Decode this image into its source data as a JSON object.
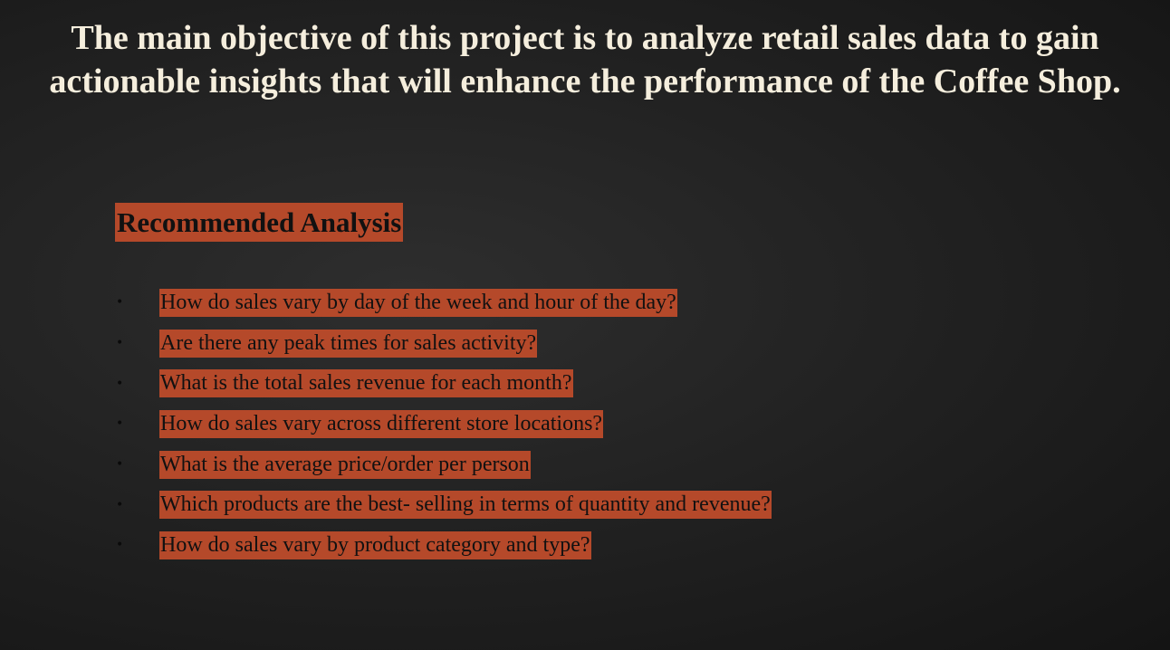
{
  "slide": {
    "title": "The main objective of this project is to analyze retail sales data to gain actionable insights that will enhance the performance of the Coffee Shop.",
    "section_heading": "Recommended Analysis",
    "bullet_glyph": "•",
    "accent_color": "#b5492a",
    "questions": [
      "How do sales vary by day of the week and hour of the day?",
      "Are there any peak times for sales activity?",
      "What is the total sales revenue for each month?",
      "How do sales vary across different store locations?",
      "What is the average price/order per person",
      "Which products are the best- selling in terms of quantity and revenue?",
      "How do sales vary by product category and type?"
    ]
  }
}
